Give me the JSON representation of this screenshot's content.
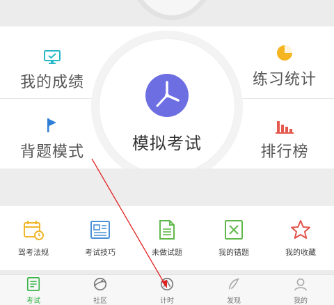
{
  "colors": {
    "accent_green": "#3bb44a",
    "clock_purple": "#6c6ee2",
    "arrow_red": "#e02020"
  },
  "quadrants": {
    "scores": {
      "label": "我的成绩",
      "icon": "monitor-check-icon"
    },
    "stats": {
      "label": "练习统计",
      "icon": "pie-chart-icon"
    },
    "memorize": {
      "label": "背题模式",
      "icon": "flag-icon"
    },
    "ranking": {
      "label": "排行榜",
      "icon": "bar-chart-icon"
    }
  },
  "center": {
    "label": "模拟考试",
    "icon": "clock-icon"
  },
  "tools": [
    {
      "label": "驾考法规",
      "icon": "calendar-icon"
    },
    {
      "label": "考试技巧",
      "icon": "document-icon"
    },
    {
      "label": "未做试题",
      "icon": "file-icon"
    },
    {
      "label": "我的错题",
      "icon": "wrong-icon"
    },
    {
      "label": "我的收藏",
      "icon": "star-icon"
    }
  ],
  "tabs": [
    {
      "label": "考试",
      "icon": "exam-list-icon",
      "active": true
    },
    {
      "label": "社区",
      "icon": "planet-icon",
      "active": false
    },
    {
      "label": "计时",
      "icon": "compass-icon",
      "active": false
    },
    {
      "label": "发现",
      "icon": "discover-icon",
      "active": false
    },
    {
      "label": "我的",
      "icon": "profile-icon",
      "active": false
    }
  ]
}
